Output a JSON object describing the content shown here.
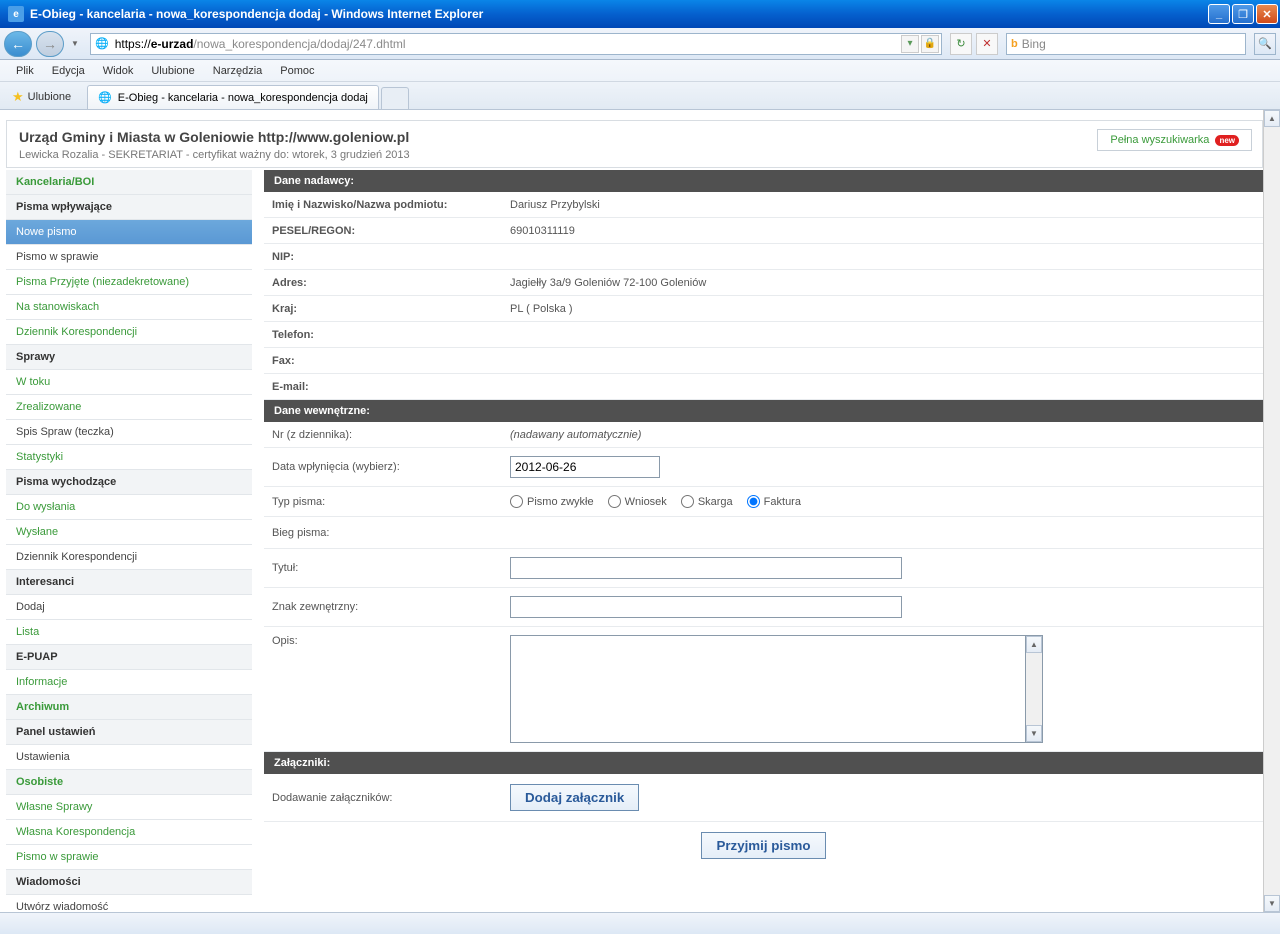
{
  "window": {
    "title": "E-Obieg - kancelaria - nowa_korespondencja dodaj - Windows Internet Explorer"
  },
  "url": {
    "protocol": "https://",
    "host": "e-urzad",
    "path": "/nowa_korespondencja/dodaj/247.dhtml"
  },
  "search": {
    "engine": "Bing"
  },
  "menubar": [
    "Plik",
    "Edycja",
    "Widok",
    "Ulubione",
    "Narzędzia",
    "Pomoc"
  ],
  "favorites_label": "Ulubione",
  "tab_title": "E-Obieg - kancelaria - nowa_korespondencja dodaj",
  "header": {
    "title": "Urząd Gminy i Miasta w Goleniowie http://www.goleniow.pl",
    "subtitle": "Lewicka Rozalia - SEKRETARIAT - certyfikat ważny do: wtorek, 3 grudzień 2013",
    "search_btn": "Pełna wyszukiwarka",
    "new_badge": "new"
  },
  "sidebar": [
    {
      "label": "Kancelaria/BOI",
      "type": "green"
    },
    {
      "label": "Pisma wpływające",
      "type": "header"
    },
    {
      "label": "Nowe pismo",
      "type": "active"
    },
    {
      "label": "Pismo w sprawie",
      "type": "normal"
    },
    {
      "label": "Pisma Przyjęte (niezadekretowane)",
      "type": "greenlink"
    },
    {
      "label": "Na stanowiskach",
      "type": "greenlink"
    },
    {
      "label": "Dziennik Korespondencji",
      "type": "greenlink"
    },
    {
      "label": "Sprawy",
      "type": "header"
    },
    {
      "label": "W toku",
      "type": "greenlink"
    },
    {
      "label": "Zrealizowane",
      "type": "greenlink"
    },
    {
      "label": "Spis Spraw (teczka)",
      "type": "normal"
    },
    {
      "label": "Statystyki",
      "type": "greenlink"
    },
    {
      "label": "Pisma wychodzące",
      "type": "header"
    },
    {
      "label": "Do wysłania",
      "type": "greenlink"
    },
    {
      "label": "Wysłane",
      "type": "greenlink"
    },
    {
      "label": "Dziennik Korespondencji",
      "type": "normal"
    },
    {
      "label": "Interesanci",
      "type": "header"
    },
    {
      "label": "Dodaj",
      "type": "normal"
    },
    {
      "label": "Lista",
      "type": "greenlink"
    },
    {
      "label": "E-PUAP",
      "type": "header"
    },
    {
      "label": "Informacje",
      "type": "greenlink"
    },
    {
      "label": "Archiwum",
      "type": "green"
    },
    {
      "label": "Panel ustawień",
      "type": "header"
    },
    {
      "label": "Ustawienia",
      "type": "normal"
    },
    {
      "label": "Osobiste",
      "type": "green"
    },
    {
      "label": "Własne Sprawy",
      "type": "greenlink"
    },
    {
      "label": "Własna Korespondencja",
      "type": "greenlink"
    },
    {
      "label": "Pismo w sprawie",
      "type": "greenlink"
    },
    {
      "label": "Wiadomości",
      "type": "header"
    },
    {
      "label": "Utwórz wiadomość",
      "type": "normal"
    }
  ],
  "sections": {
    "sender": {
      "title": "Dane nadawcy:",
      "fields": {
        "name_label": "Imię i Nazwisko/Nazwa podmiotu:",
        "name_value": "Dariusz Przybylski",
        "pesel_label": "PESEL/REGON:",
        "pesel_value": "69010311119",
        "nip_label": "NIP:",
        "nip_value": "",
        "address_label": "Adres:",
        "address_value": "Jagiełły 3a/9 Goleniów 72-100 Goleniów",
        "country_label": "Kraj:",
        "country_value": "PL ( Polska )",
        "phone_label": "Telefon:",
        "phone_value": "",
        "fax_label": "Fax:",
        "fax_value": "",
        "email_label": "E-mail:",
        "email_value": ""
      }
    },
    "internal": {
      "title": "Dane wewnętrzne:",
      "fields": {
        "nr_label": "Nr (z dziennika):",
        "nr_value": "(nadawany automatycznie)",
        "date_label": "Data wpłynięcia (wybierz):",
        "date_value": "2012-06-26",
        "type_label": "Typ pisma:",
        "type_options": [
          "Pismo zwykłe",
          "Wniosek",
          "Skarga",
          "Faktura"
        ],
        "type_selected": "Faktura",
        "bieg_label": "Bieg pisma:",
        "title_label": "Tytuł:",
        "title_value": "",
        "znak_label": "Znak zewnętrzny:",
        "znak_value": "",
        "opis_label": "Opis:",
        "opis_value": ""
      }
    },
    "attachments": {
      "title": "Załączniki:",
      "add_label": "Dodawanie załączników:",
      "add_btn": "Dodaj załącznik"
    }
  },
  "submit_btn": "Przyjmij pismo"
}
